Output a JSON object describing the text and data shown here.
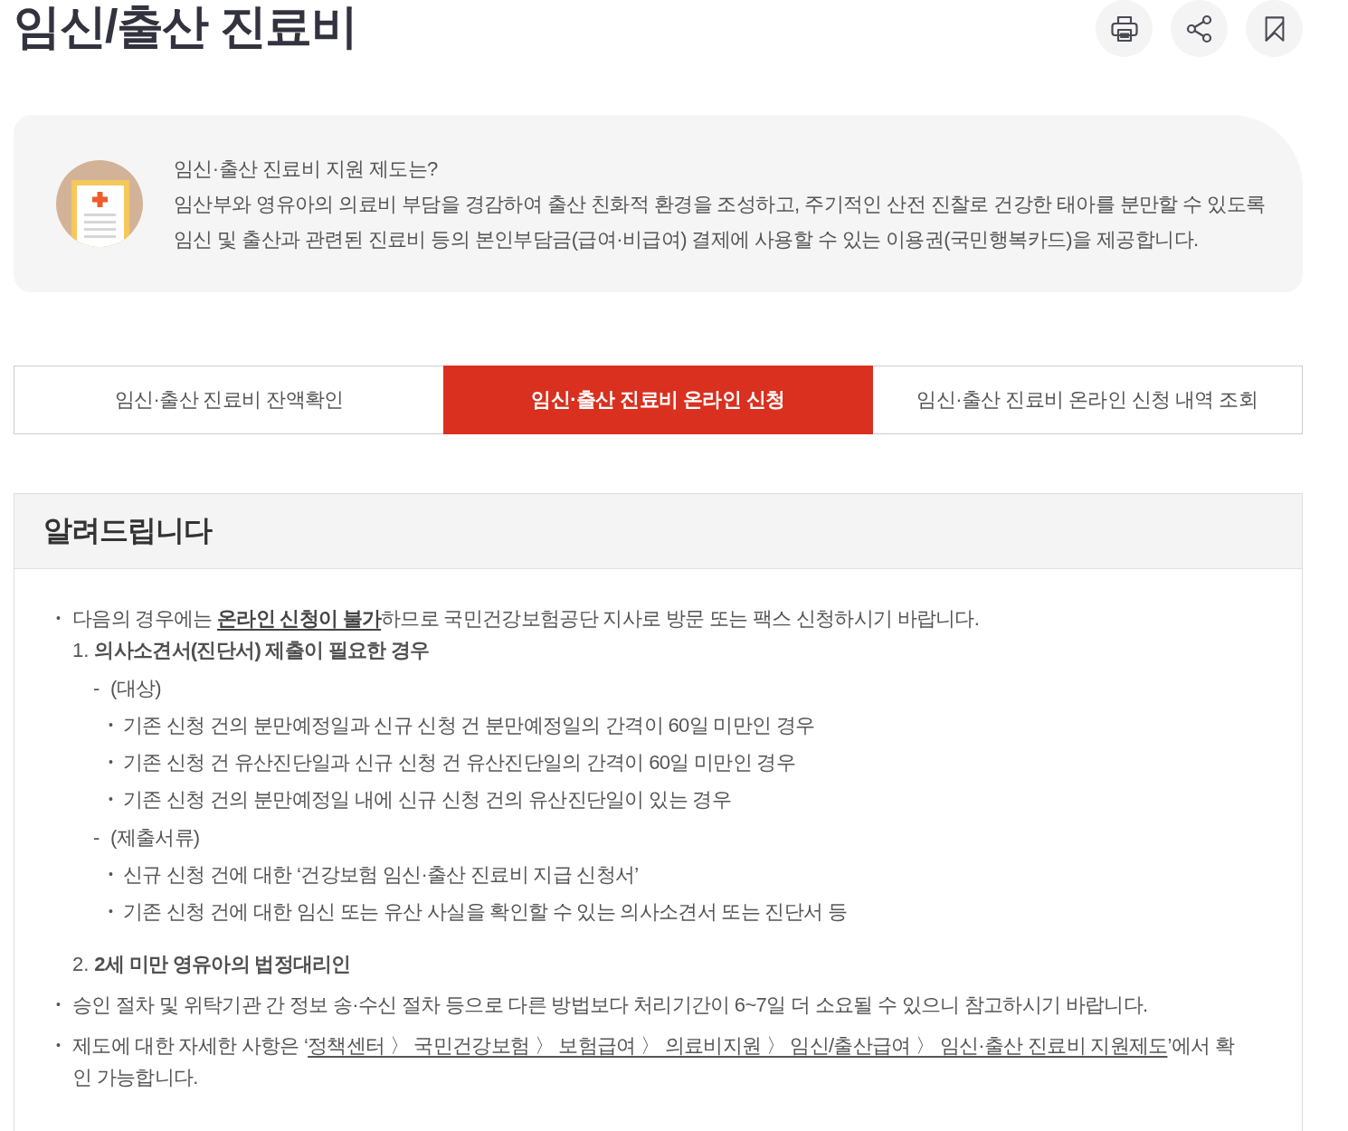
{
  "page_title": "임신/출산 진료비",
  "intro": {
    "title": "임신·출산 진료비 지원 제도는?",
    "description": "임산부와 영유아의 의료비 부담을 경감하여 출산 친화적 환경을 조성하고, 주기적인 산전 진찰로 건강한 태아를 분만할 수 있도록\n임신 및 출산과 관련된 진료비 등의 본인부담금(급여·비급여) 결제에 사용할 수 있는 이용권(국민행복카드)을 제공합니다."
  },
  "tabs": [
    {
      "label": "임신·출산 진료비 잔액확인",
      "selected": false
    },
    {
      "label": "임신·출산 진료비 온라인 신청",
      "selected": true
    },
    {
      "label": "임신·출산 진료비 온라인 신청 내역 조회",
      "selected": false
    }
  ],
  "notice": {
    "title": "알려드립니다",
    "items": [
      {
        "kind": "bullet",
        "marker": "•",
        "text": "다음의 경우에는 **온라인 신청이 불가**하므로 국민건강보험공단 지사로 방문 또는 팩스 신청하시기 바랍니다.",
        "children": [
          {
            "kind": "numbered",
            "marker": "1.",
            "text": "의사소견서(진단서) 제출이 필요한 경우",
            "children": [
              {
                "kind": "dash",
                "marker": "-",
                "text": "(대상)",
                "children": [
                  {
                    "kind": "dot",
                    "marker": "•",
                    "text": "기존 신청 건의 분만예정일과 신규 신청 건 분만예정일의 간격이 60일 미만인 경우"
                  },
                  {
                    "kind": "dot",
                    "marker": "•",
                    "text": "기존 신청 건 유산진단일과 신규 신청 건 유산진단일의 간격이 60일 미만인 경우"
                  },
                  {
                    "kind": "dot",
                    "marker": "•",
                    "text": "기존 신청 건의 분만예정일 내에 신규 신청 건의 유산진단일이 있는 경우"
                  }
                ]
              },
              {
                "kind": "dash",
                "marker": "-",
                "text": "(제출서류)",
                "children": [
                  {
                    "kind": "dot",
                    "marker": "•",
                    "text": "신규 신청 건에 대한 ‘건강보험 임신·출산 진료비 지급 신청서’"
                  },
                  {
                    "kind": "dot",
                    "marker": "•",
                    "text": "기존 신청 건에 대한 임신 또는 유산 사실을 확인할 수 있는 의사소견서 또는 진단서 등"
                  }
                ]
              }
            ]
          },
          {
            "kind": "numbered",
            "marker": "2.",
            "text": "2세 미만 영유아의 법정대리인"
          }
        ]
      },
      {
        "kind": "bullet",
        "marker": "•",
        "text": "승인 절차 및 위탁기관 간 정보 송·수신 절차 등으로 다른 방법보다 처리기간이 6~7일 더 소요될 수 있으니 참고하시기 바랍니다."
      },
      {
        "kind": "bullet",
        "marker": "•",
        "text": "제도에 대한 자세한 사항은 ‘",
        "link": "정책센터 〉 국민건강보험 〉 보험급여 〉 의료비지원 〉 임신/출산급여 〉 임신·출산 진료비 지원제도",
        "text_after": "’에서 확인 가능합니다."
      }
    ]
  }
}
